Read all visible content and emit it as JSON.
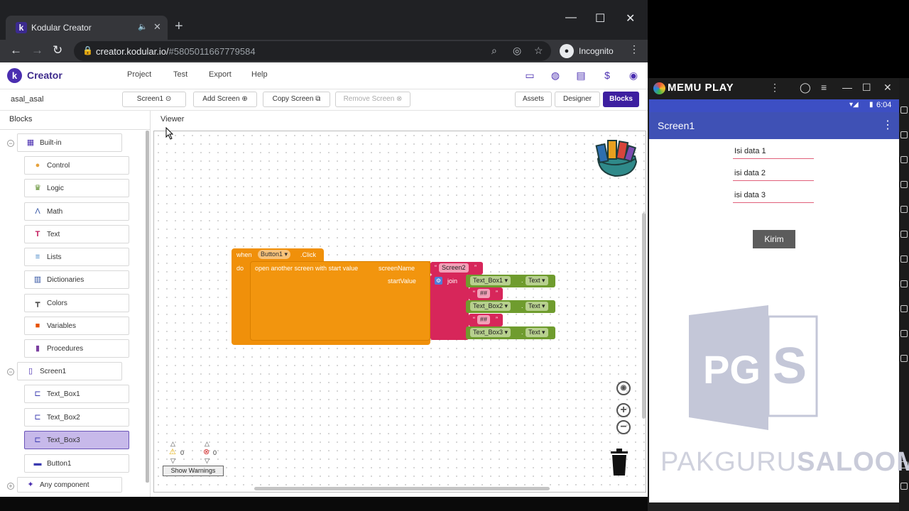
{
  "browser": {
    "tab_title": "Kodular Creator",
    "url_host": "creator.kodular.io/",
    "url_hash": "#5805011667779584",
    "incognito_label": "Incognito",
    "new_tab_symbol": "+",
    "window_controls": [
      "—",
      "☐",
      "✕"
    ]
  },
  "header": {
    "logo_letter": "k",
    "app_name": "Creator",
    "menu": [
      "Project",
      "Test",
      "Export",
      "Help"
    ]
  },
  "toolbar": {
    "project_name": "asal_asal",
    "screen_select": "Screen1",
    "add_screen": "Add Screen",
    "copy_screen": "Copy Screen",
    "remove_screen": "Remove Screen",
    "assets": "Assets",
    "designer": "Designer",
    "blocks": "Blocks"
  },
  "blocks_panel": {
    "title": "Blocks",
    "builtin_label": "Built-in",
    "builtin_items": [
      {
        "label": "Control",
        "icon": "control-icon",
        "color": "#e6a23c"
      },
      {
        "label": "Logic",
        "icon": "logic-icon",
        "color": "#5b8c2a"
      },
      {
        "label": "Math",
        "icon": "math-icon",
        "color": "#3b5ba8"
      },
      {
        "label": "Text",
        "icon": "text-icon",
        "color": "#c2185b"
      },
      {
        "label": "Lists",
        "icon": "lists-icon",
        "color": "#3b7fc4"
      },
      {
        "label": "Dictionaries",
        "icon": "dictionaries-icon",
        "color": "#2d4fa0"
      },
      {
        "label": "Colors",
        "icon": "colors-icon",
        "color": "#555555"
      },
      {
        "label": "Variables",
        "icon": "variables-icon",
        "color": "#e65100"
      },
      {
        "label": "Procedures",
        "icon": "procedures-icon",
        "color": "#7b3fa0"
      }
    ],
    "screen_label": "Screen1",
    "screen_items": [
      {
        "label": "Text_Box1"
      },
      {
        "label": "Text_Box2"
      },
      {
        "label": "Text_Box3"
      },
      {
        "label": "Button1"
      }
    ],
    "any_component": "Any component"
  },
  "viewer": {
    "title": "Viewer",
    "when": "when",
    "event_component": "Button1",
    "event_name": ".Click",
    "do": "do",
    "action": "open another screen with start value",
    "screen_name_label": "screenName",
    "screen_name_value": "Screen2",
    "start_value_label": "startValue",
    "join": "join",
    "join_items": [
      {
        "component": "Text_Box1",
        "property": "Text"
      },
      {
        "separator": "##"
      },
      {
        "component": "Text_Box2",
        "property": "Text"
      },
      {
        "separator": "##"
      },
      {
        "component": "Text_Box3",
        "property": "Text"
      }
    ],
    "warnings_count": "0",
    "errors_count": "0",
    "show_warnings": "Show Warnings"
  },
  "emulator": {
    "title": "MEMU PLAY",
    "time": "6:04",
    "screen_title": "Screen1",
    "inputs": [
      "Isi data 1",
      "isi data 2",
      "isi data 3"
    ],
    "button": "Kirim"
  },
  "watermark": {
    "text_a": "PAKGURU",
    "text_b": "SALOOM",
    "logo_letters": "PG S"
  }
}
